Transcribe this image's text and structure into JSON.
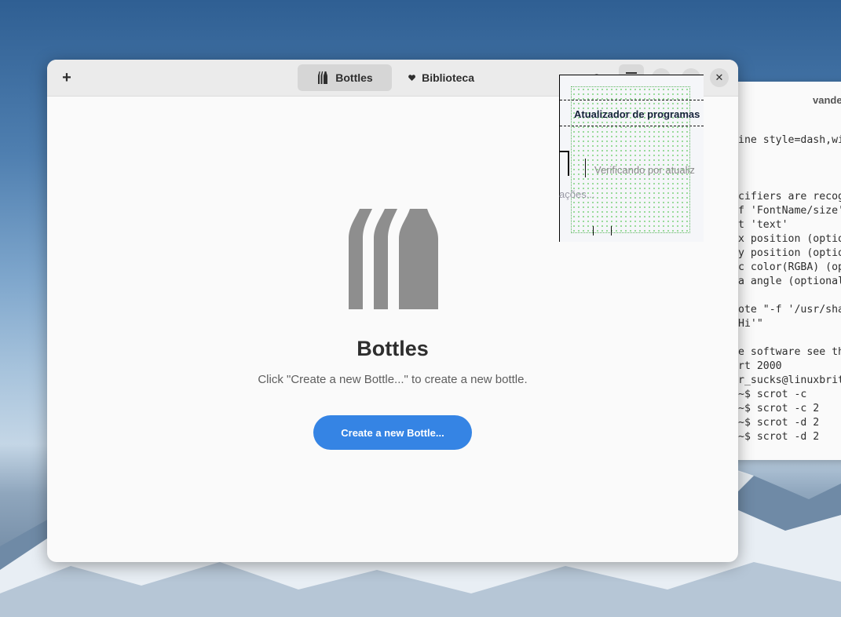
{
  "terminal": {
    "title": "vande",
    "lines": [
      "ine style=dash,wi",
      "",
      "",
      "",
      "cifiers are recog",
      "f 'FontName/size'",
      "t 'text'",
      "x position (optio",
      "y position (optio",
      "c color(RGBA) (op",
      "a angle (optional",
      "",
      "ote \"-f '/usr/sha",
      "Hi'\"",
      "",
      "e software see th",
      "rt 2000",
      "r_sucks@linuxbrit",
      "~$ scrot -c",
      "~$ scrot -c 2",
      "~$ scrot -d 2",
      "~$ scrot -d 2"
    ]
  },
  "headerbar": {
    "add_label": "+",
    "tabs": [
      {
        "label": "Bottles",
        "icon": "bottles-icon",
        "active": true
      },
      {
        "label": "Biblioteca",
        "icon": "heart-icon",
        "active": false
      }
    ],
    "close_label": "✕"
  },
  "empty_state": {
    "title": "Bottles",
    "description": "Click \"Create a new Bottle...\" to create a new bottle.",
    "button_label": "Create a new Bottle..."
  },
  "popup": {
    "title": "Atualizador de programas",
    "status": "Verificando por atualiz",
    "stray_text": "ações..."
  },
  "colors": {
    "accent": "#3584e4",
    "icon_gray": "#8e8e8e",
    "headerbar": "#ebebeb"
  }
}
